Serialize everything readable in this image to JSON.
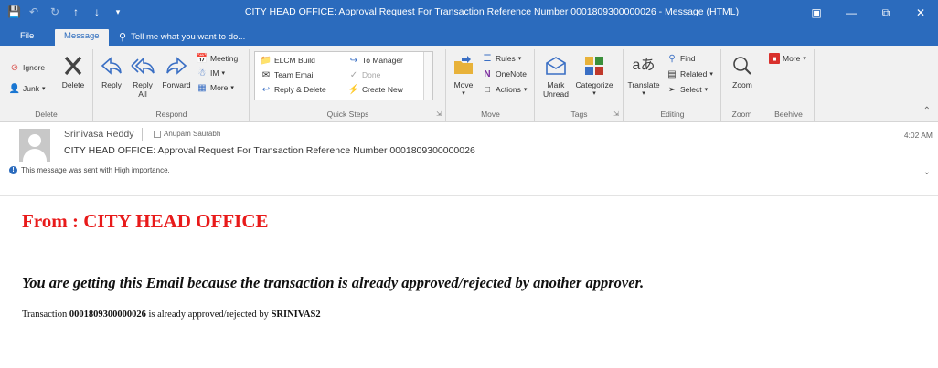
{
  "window": {
    "title": "CITY HEAD OFFICE: Approval Request For Transaction Reference Number 0001809300000026 - Message (HTML)"
  },
  "tabs": {
    "file": "File",
    "message": "Message",
    "tell_me": "Tell me what you want to do..."
  },
  "ribbon": {
    "delete_group": {
      "ignore": "Ignore",
      "junk": "Junk",
      "delete": "Delete",
      "name": "Delete"
    },
    "respond_group": {
      "reply": "Reply",
      "reply_all_1": "Reply",
      "reply_all_2": "All",
      "forward": "Forward",
      "meeting": "Meeting",
      "im": "IM",
      "more": "More",
      "name": "Respond"
    },
    "quick_steps": {
      "elcm_build": "ELCM Build",
      "team_email": "Team Email",
      "reply_delete": "Reply & Delete",
      "to_manager": "To Manager",
      "done": "Done",
      "create_new": "Create New",
      "name": "Quick Steps"
    },
    "move_group": {
      "move": "Move",
      "rules": "Rules",
      "onenote": "OneNote",
      "actions": "Actions",
      "name": "Move"
    },
    "tags_group": {
      "mark_unread_1": "Mark",
      "mark_unread_2": "Unread",
      "categorize": "Categorize",
      "name": "Tags"
    },
    "editing_group": {
      "translate": "Translate",
      "find": "Find",
      "related": "Related",
      "select": "Select",
      "name": "Editing"
    },
    "zoom_group": {
      "zoom": "Zoom",
      "name": "Zoom"
    },
    "beehive_group": {
      "more": "More",
      "name": "Beehive"
    }
  },
  "message": {
    "sender": "Srinivasa Reddy",
    "recipient": "Anupam Saurabh",
    "time": "4:02 AM",
    "subject": "CITY HEAD OFFICE: Approval Request For Transaction Reference Number 0001809300000026",
    "importance": "This message was sent with High importance."
  },
  "body": {
    "from_line": "From : CITY HEAD OFFICE",
    "notice": "You are getting this Email because the transaction is already approved/rejected by another approver.",
    "tx_prefix": "Transaction",
    "tx_number": "0001809300000026",
    "tx_middle": "is already approved/rejected by",
    "tx_approver": "SRINIVAS2"
  },
  "colors": {
    "accent": "#2b6bbd",
    "from_red": "#e81a1a"
  }
}
